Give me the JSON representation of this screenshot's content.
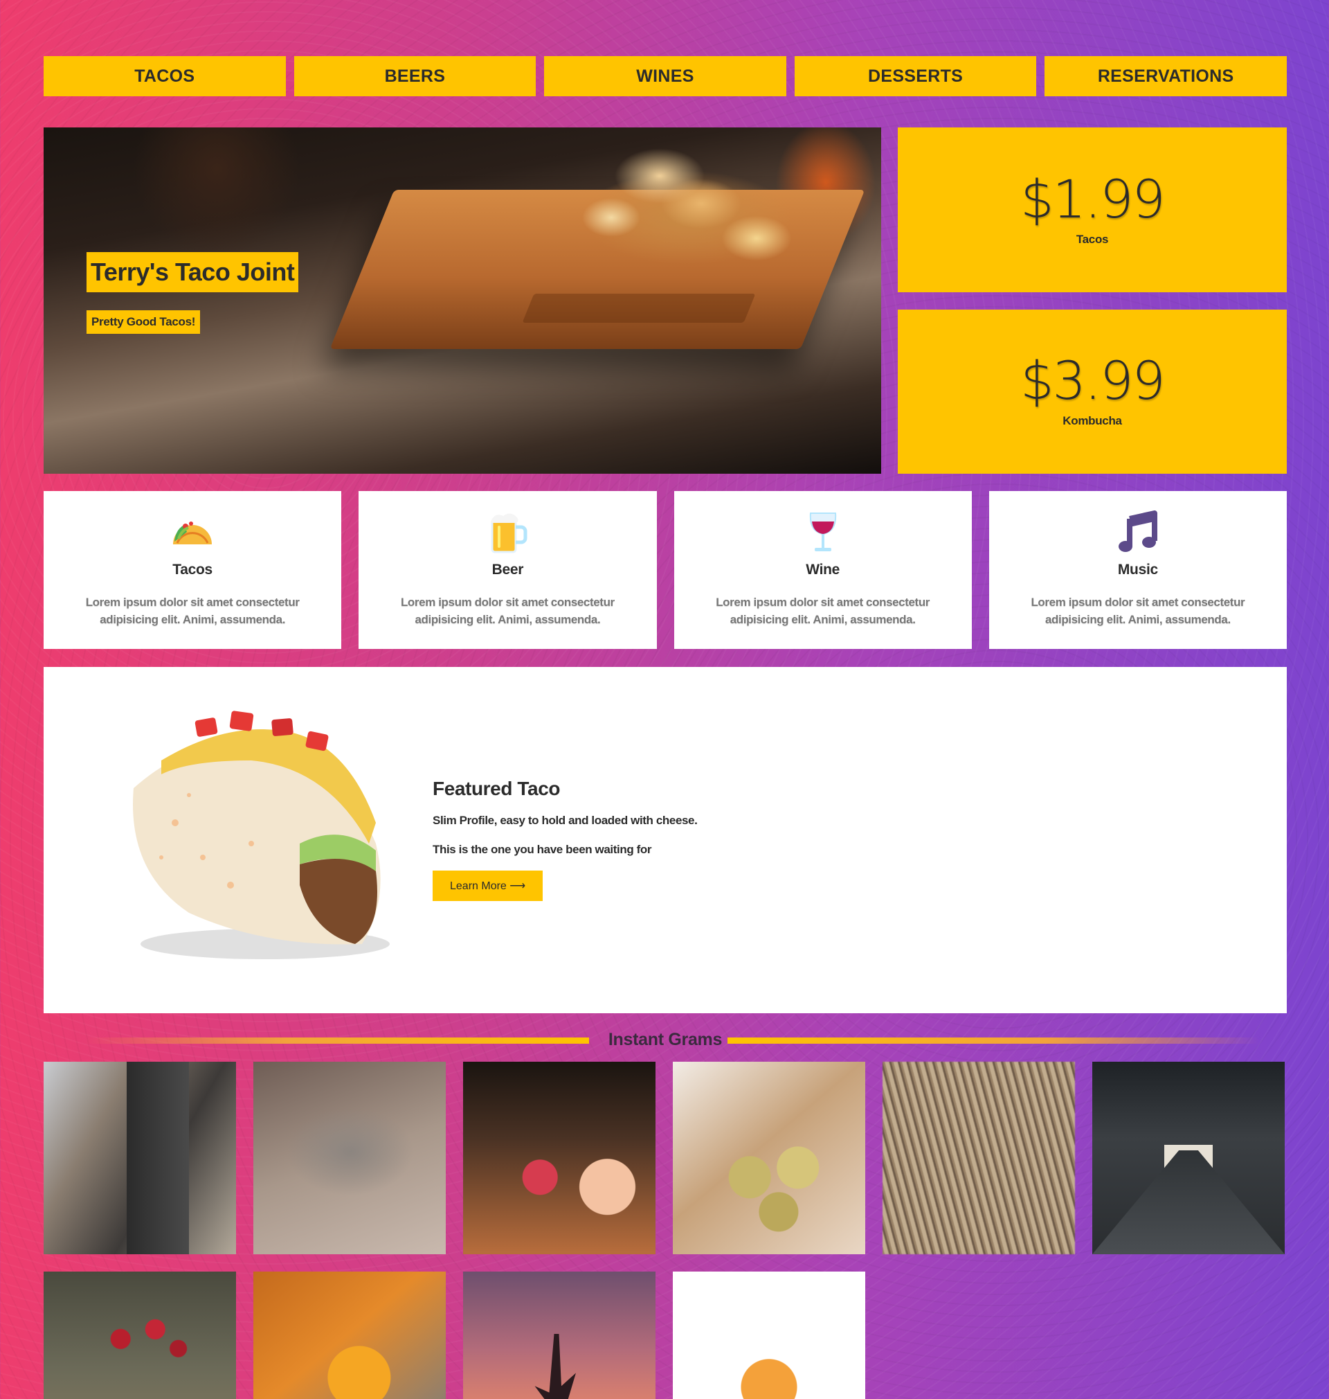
{
  "nav": {
    "items": [
      "TACOS",
      "BEERS",
      "WINES",
      "DESSERTS",
      "RESERVATIONS"
    ]
  },
  "hero": {
    "title": "Terry's Taco Joint",
    "subtitle": "Pretty Good Tacos!"
  },
  "prices": [
    {
      "amount": "$1.99",
      "label": "Tacos"
    },
    {
      "amount": "$3.99",
      "label": "Kombucha"
    }
  ],
  "features": [
    {
      "icon": "taco-icon",
      "title": "Tacos",
      "text": "Lorem ipsum dolor sit amet consectetur adipisicing elit. Animi, assumenda."
    },
    {
      "icon": "beer-icon",
      "title": "Beer",
      "text": "Lorem ipsum dolor sit amet consectetur adipisicing elit. Animi, assumenda."
    },
    {
      "icon": "wine-icon",
      "title": "Wine",
      "text": "Lorem ipsum dolor sit amet consectetur adipisicing elit. Animi, assumenda."
    },
    {
      "icon": "music-note-icon",
      "title": "Music",
      "text": "Lorem ipsum dolor sit amet consectetur adipisicing elit. Animi, assumenda."
    }
  ],
  "featured": {
    "title": "Featured Taco",
    "line1": "Slim Profile, easy to hold and loaded with cheese.",
    "line2": "This is the one you have been waiting for",
    "button": "Learn More ⟶"
  },
  "grams": {
    "title": "Instant Grams",
    "count": 10
  },
  "colors": {
    "accent": "#ffc400",
    "gradient_start": "#ee3d6d",
    "gradient_end": "#7d44cf",
    "text": "#2b2b2b"
  }
}
